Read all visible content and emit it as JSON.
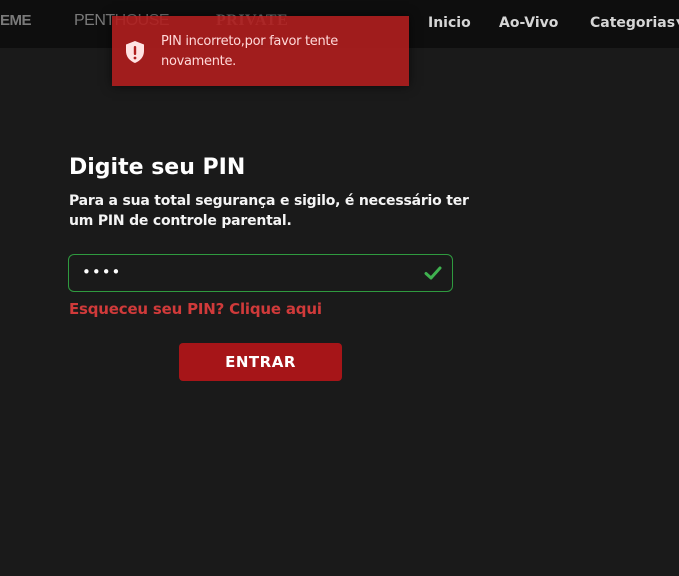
{
  "header": {
    "brands": [
      "EME",
      "PENTHOUSE",
      "PRIVATE"
    ],
    "nav": {
      "inicio": "Inicio",
      "aovivo": "Ao-Vivo",
      "categorias": "Categorias"
    }
  },
  "toast": {
    "message": "PIN incorreto,por favor tente novamente.",
    "icon": "shield-alert-icon",
    "color": "#b01e1e"
  },
  "pin_form": {
    "title": "Digite seu PIN",
    "description": "Para a sua total segurança e sigilo, é necessário ter um PIN de controle parental.",
    "pin_value": "••••",
    "valid_color": "#2f9a3f",
    "forgot_link": "Esqueceu seu PIN? Clique aqui",
    "submit_label": "ENTRAR",
    "submit_color": "#a61518"
  }
}
